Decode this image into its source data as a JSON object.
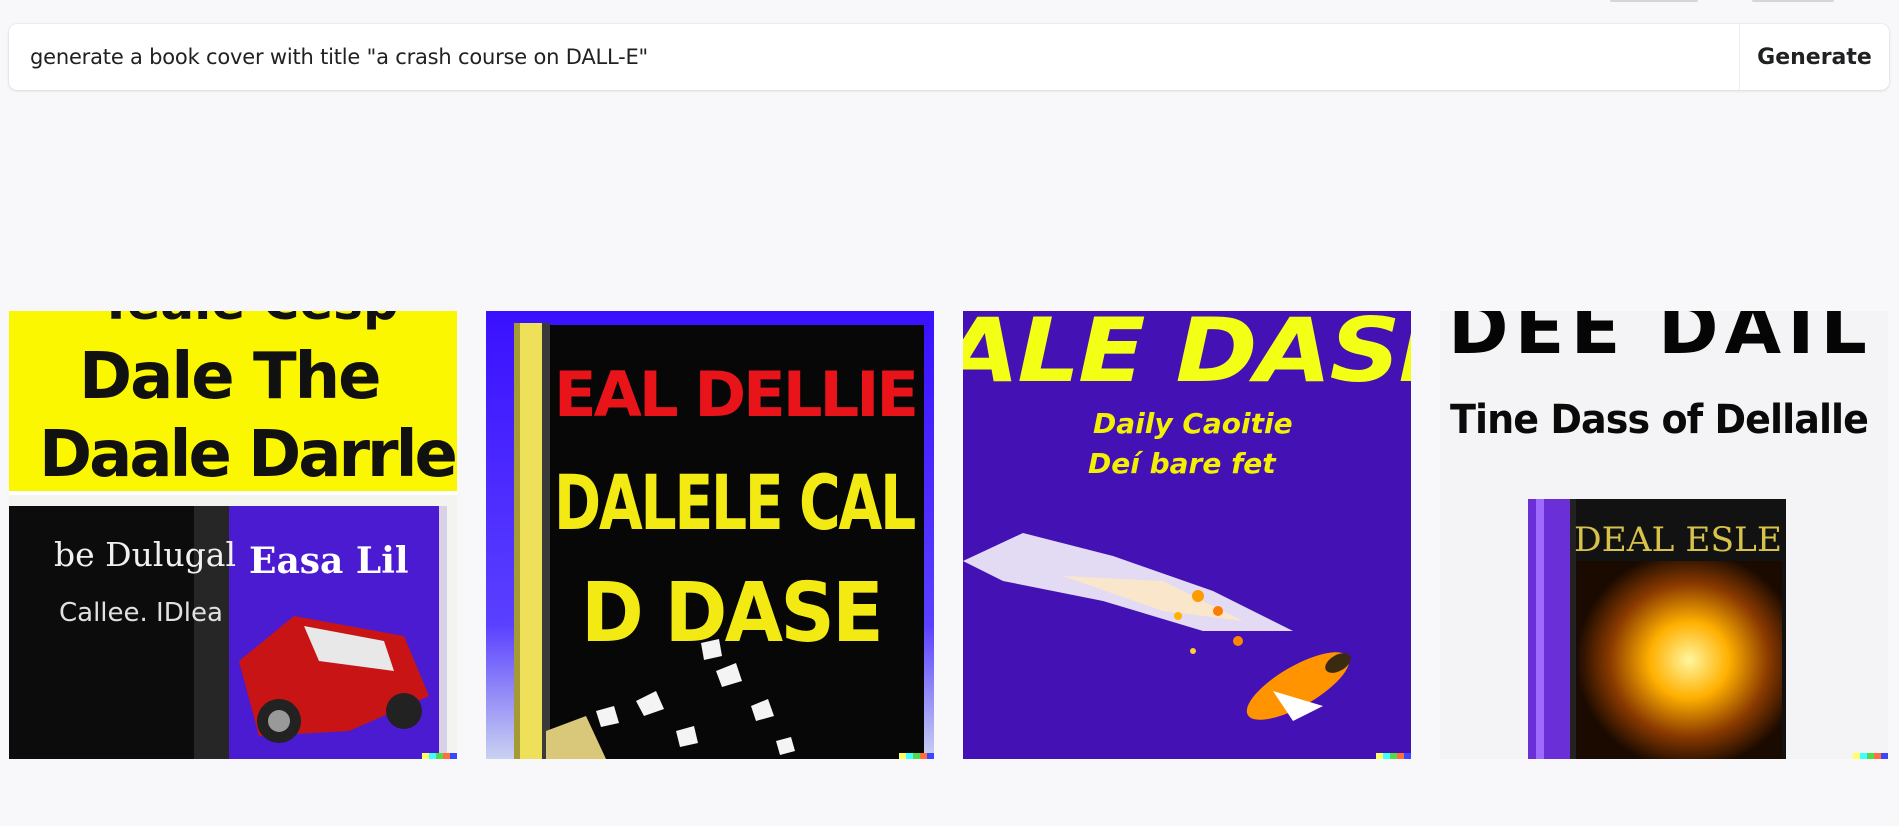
{
  "prompt": {
    "value": "generate a book cover with title \"a crash course on DALL-E\""
  },
  "generate_label": "Generate",
  "results": [
    {
      "name": "image-result-1",
      "texts": [
        "Teale Cesp",
        "Dale The",
        "Daale Darrle",
        "be Dulugal",
        "Callee. IDlea",
        "Easa Lil"
      ]
    },
    {
      "name": "image-result-2",
      "texts": [
        "EAL DELLIE",
        "DALELE CAL",
        "D DASE"
      ]
    },
    {
      "name": "image-result-3",
      "texts": [
        "ALE DASI",
        "Daily Caoitie",
        "Deí bare fet"
      ]
    },
    {
      "name": "image-result-4",
      "texts": [
        "DEE DAIL",
        "Tine Dass of Dellalle",
        "DEAL ESLE"
      ]
    }
  ],
  "colors": {
    "signature": [
      "#ffff66",
      "#42ffff",
      "#51da4c",
      "#ff6e3c",
      "#3c46ff"
    ]
  }
}
